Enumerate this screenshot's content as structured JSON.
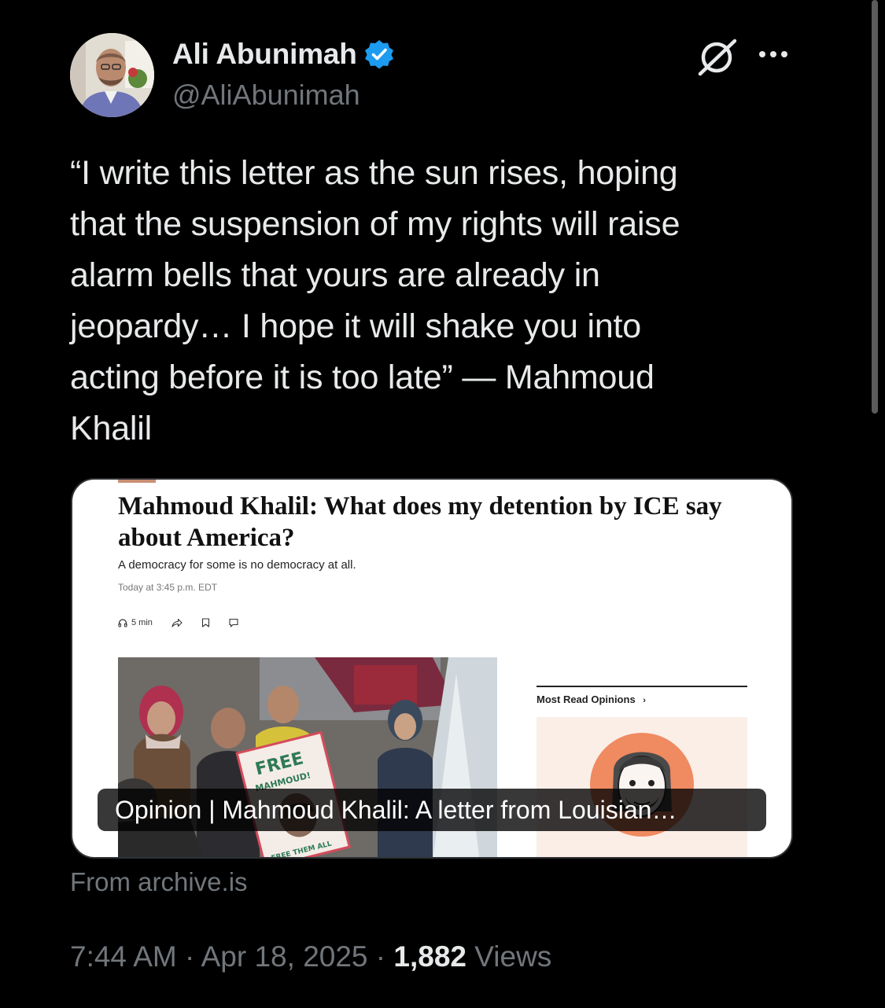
{
  "author": {
    "name": "Ali Abunimah",
    "handle": "@AliAbunimah",
    "verified": true,
    "avatar_icon": "user-avatar"
  },
  "icons": {
    "verified": "verified-badge-icon",
    "grok": "grok-icon",
    "more": "more-options-icon"
  },
  "colors": {
    "background": "#000000",
    "text": "#e7e9ea",
    "secondary_text": "#71767b",
    "verified_blue": "#1d9bf0"
  },
  "tweet": {
    "text": "“I write this letter as the sun rises, hoping\nthat the suspension of my rights will raise\nalarm bells that yours are already in\njeopardy… I hope it will shake you into\nacting before it is too late” — Mahmoud\nKhalil"
  },
  "card": {
    "preview": {
      "headline": "Mahmoud Khalil: What does my detention by ICE say about America?",
      "subhead": "A democracy for some is no democracy at all.",
      "date": "Today at 3:45 p.m. EDT",
      "listen_label": "5 min",
      "most_read_label": "Most Read Opinions",
      "sign_text_1": "FREE",
      "sign_text_2": "MAHMOUD!",
      "sign_text_3": "FREE THEM ALL"
    },
    "caption": "Opinion | Mahmoud Khalil: A letter from Louisian…",
    "source": "From archive.is"
  },
  "meta": {
    "time": "7:44 AM",
    "separator": "·",
    "date": "Apr 18, 2025",
    "views_count": "1,882",
    "views_label": "Views"
  }
}
